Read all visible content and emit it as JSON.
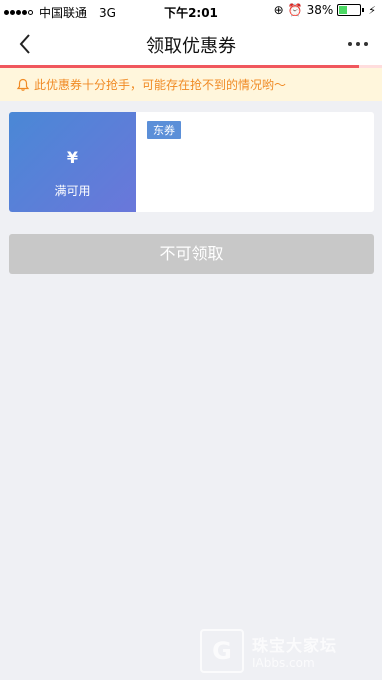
{
  "status_bar": {
    "carrier": "中国联通",
    "network": "3G",
    "time": "下午2:01",
    "battery_percent": "38%",
    "battery_level": 0.38
  },
  "nav": {
    "title": "领取优惠券",
    "progress": 0.94
  },
  "notice": {
    "text": "此优惠券十分抢手，可能存在抢不到的情况哟～",
    "icon": "bell-icon"
  },
  "coupon": {
    "amount": "¥",
    "condition": "满可用",
    "tag": "东券"
  },
  "claim_button": {
    "label": "不可领取"
  },
  "watermark": {
    "logo": "G",
    "title": "珠宝大家坛",
    "subtitle": "IAbbs.com"
  },
  "colors": {
    "coupon_gradient_start": "#4a88d6",
    "coupon_gradient_end": "#6a77da",
    "notice_text": "#f08a24",
    "disabled_button": "#c8c8c8",
    "progress": "#f0575d"
  }
}
